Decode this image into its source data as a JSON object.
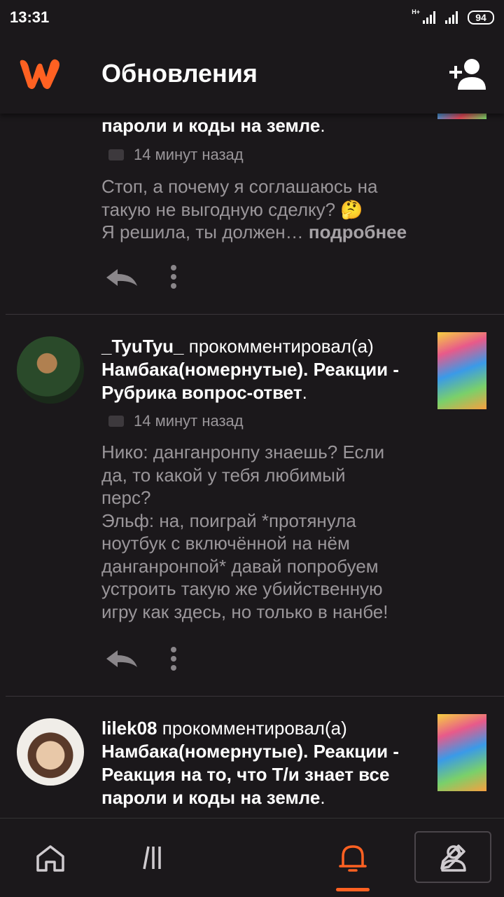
{
  "status_bar": {
    "time": "13:31",
    "network": "H+",
    "battery": "94"
  },
  "header": {
    "title": "Обновления"
  },
  "colors": {
    "accent": "#ff6122",
    "background": "#1b181b",
    "muted_text": "#9a969a"
  },
  "feed": [
    {
      "user": "",
      "action": "",
      "story_title": "пароли и коды на земле",
      "story_tail": ".",
      "time": "14 минут назад",
      "comment": "Стоп, а почему я соглашаюсь на\nтакую не выгодную сделку? 🤔\nЯ решила, ты должен…",
      "more_label": "подробнее"
    },
    {
      "user": "_TyuTyu_",
      "action": "прокомментировал(а)",
      "story_title": "Намбака(номернутые). Реакции - Рубрика вопрос-ответ",
      "story_tail": ".",
      "time": "14 минут назад",
      "comment": "Нико: данганронпу знаешь? Если\nда, то какой у тебя любимый\nперс?\nЭльф: на, поиграй *протянула\nноутбук с включённой на нём\nданганронпой* давай попробуем\nустроить такую же убийственную\nигру как здесь, но только в нанбе!"
    },
    {
      "user": "lilek08",
      "action": "прокомментировал(а)",
      "story_title": "Намбака(номернутые). Реакции - Реакция на то, что Т/и знает все пароли и коды на земле",
      "story_tail": "."
    }
  ],
  "bottom_nav": {
    "items": [
      "home-icon",
      "library-icon",
      "write-icon",
      "notifications-icon",
      "profile-icon"
    ],
    "active": "notifications-icon"
  }
}
